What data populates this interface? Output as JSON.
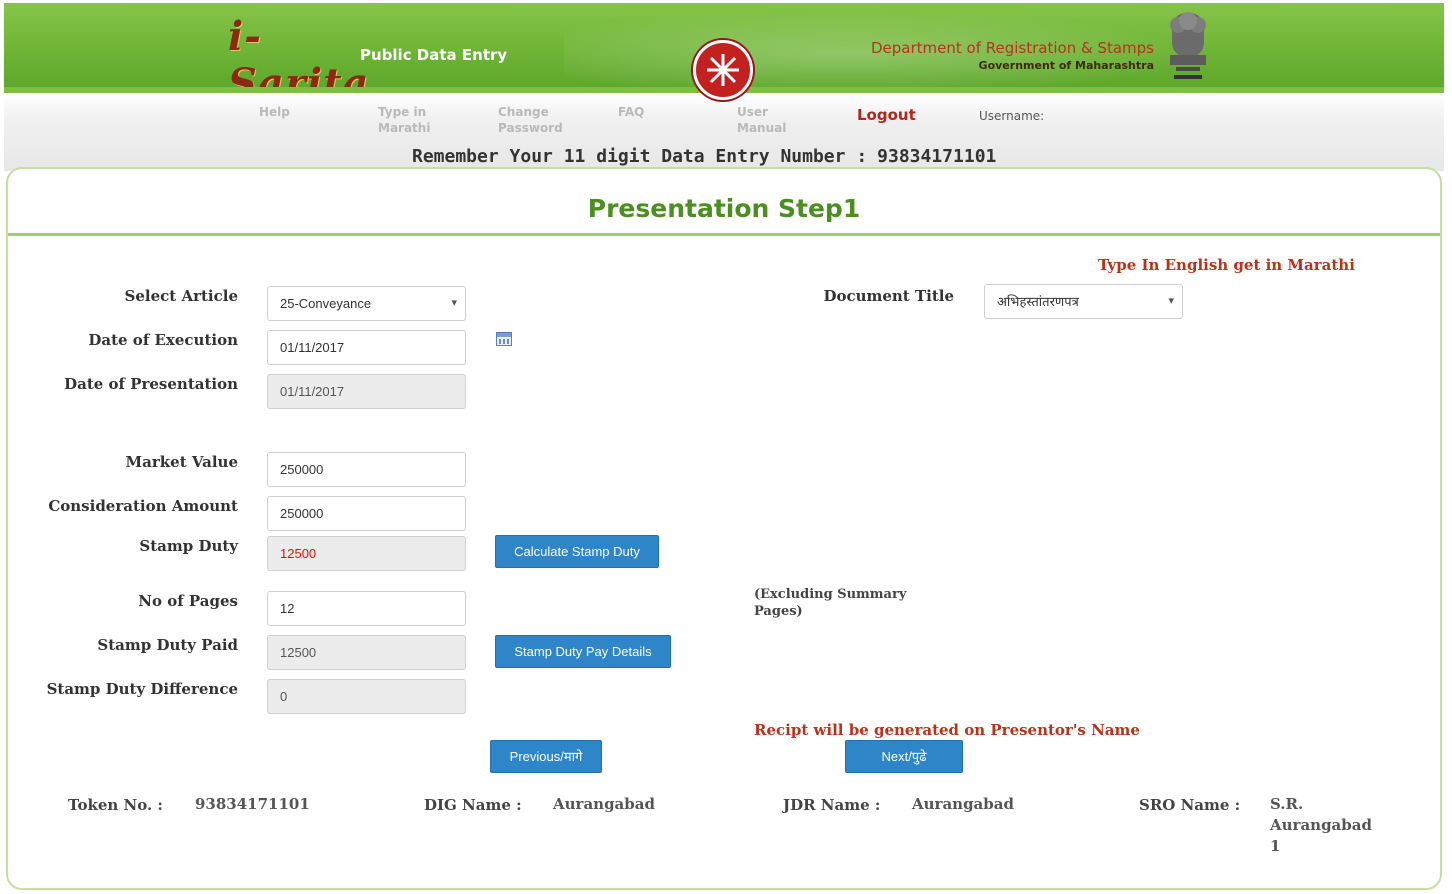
{
  "header": {
    "logo_text": "i-Sarita",
    "app_name": "Public Data Entry",
    "department": "Department of Registration & Stamps",
    "government": "Government of Maharashtra",
    "center_emblem_icon": "seal-icon",
    "right_emblem_icon": "national-emblem-icon"
  },
  "nav": {
    "items": [
      "Help",
      "Type in Marathi",
      "Change Password",
      "FAQ",
      "User Manual"
    ],
    "logout": "Logout",
    "username_label": "Username:",
    "remember_text": "Remember Your 11 digit Data Entry Number :",
    "data_entry_number": "93834171101"
  },
  "page": {
    "title": "Presentation Step1",
    "marathi_hint": "Type In English get in Marathi"
  },
  "form": {
    "select_article": {
      "label": "Select Article",
      "value": "25-Conveyance"
    },
    "document_title": {
      "label": "Document Title",
      "value": "अभिहस्तांतरणपत्र"
    },
    "date_execution": {
      "label": "Date of Execution",
      "value": "01/11/2017"
    },
    "date_presentation": {
      "label": "Date of Presentation",
      "value": "01/11/2017"
    },
    "market_value": {
      "label": "Market Value",
      "value": "250000"
    },
    "consideration_amount": {
      "label": "Consideration Amount",
      "value": "250000"
    },
    "stamp_duty": {
      "label": "Stamp Duty",
      "value": "12500"
    },
    "calculate_button": "Calculate Stamp Duty",
    "no_of_pages": {
      "label": "No of Pages",
      "value": "12"
    },
    "pages_note": "(Excluding Summary Pages)",
    "stamp_duty_paid": {
      "label": "Stamp Duty Paid",
      "value": "12500"
    },
    "pay_details_button": "Stamp Duty Pay Details",
    "stamp_duty_difference": {
      "label": "Stamp Duty Difference",
      "value": "0"
    },
    "receipt_note": "Recipt will be generated on Presentor's Name",
    "previous_button": "Previous/मागे",
    "next_button": "Next/पुढे"
  },
  "footer": {
    "token_label": "Token No. :",
    "token_value": "93834171101",
    "dig_label": "DIG Name :",
    "dig_value": "Aurangabad",
    "jdr_label": "JDR Name :",
    "jdr_value": "Aurangabad",
    "sro_label": "SRO Name :",
    "sro_value_1": "S.R.",
    "sro_value_2": "Aurangabad",
    "sro_value_3": "1"
  },
  "colors": {
    "header_green": "#6fb536",
    "title_green": "#4a8f1f",
    "accent_red": "#b8331a",
    "button_blue": "#2e86c9"
  }
}
